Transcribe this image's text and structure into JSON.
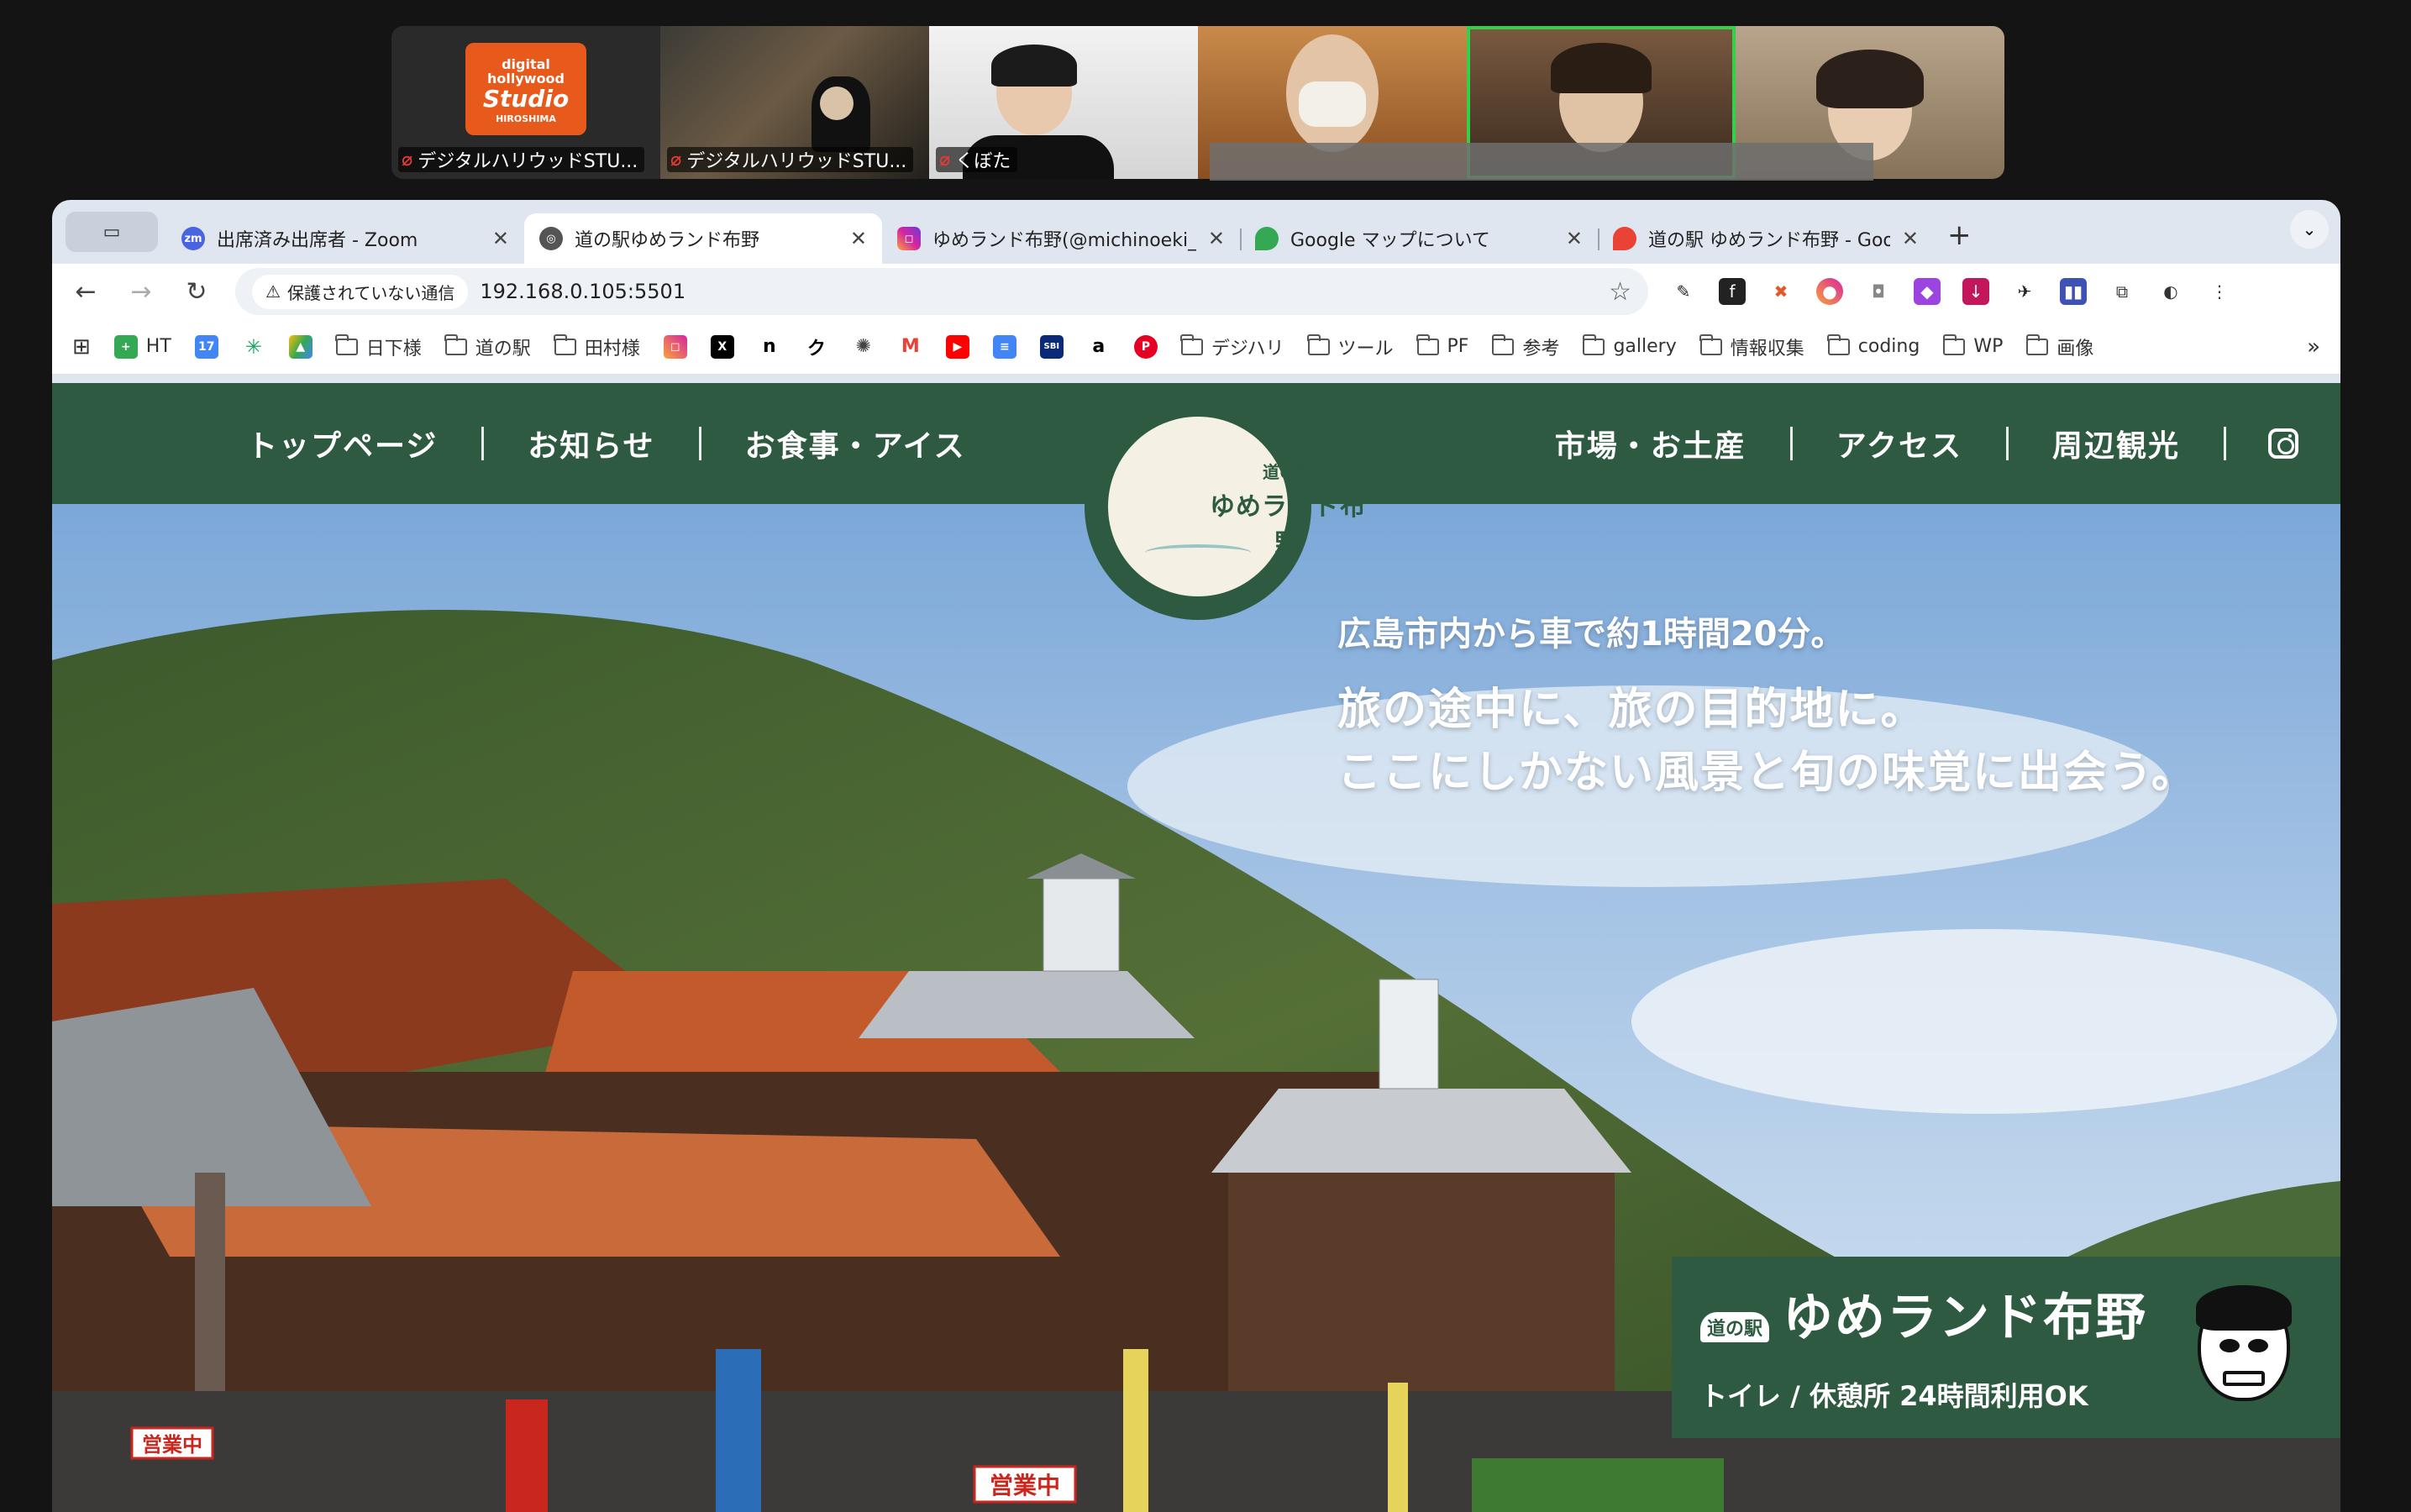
{
  "zoom": {
    "participants": [
      {
        "name": "デジタルハリウッドSTU...",
        "muted": true,
        "logo_text_top": "digital hollywood",
        "logo_text_main": "Studio",
        "logo_text_bottom": "HIROSHIMA"
      },
      {
        "name": "デジタルハリウッドSTU...",
        "muted": true
      },
      {
        "name": "くぼた",
        "muted": true
      },
      {
        "name": "",
        "muted": false
      },
      {
        "name": "",
        "muted": false,
        "active": true
      },
      {
        "name": "",
        "muted": false
      }
    ]
  },
  "browser": {
    "tabs": [
      {
        "label": "出席済み出席者 - Zoom",
        "icon": "zoom-icon"
      },
      {
        "label": "道の駅ゆめランド布野",
        "icon": "globe-icon",
        "active": true
      },
      {
        "label": "ゆめランド布野(@michinoeki_f",
        "icon": "instagram-icon"
      },
      {
        "label": "Google マップについて",
        "icon": "google-maps-icon"
      },
      {
        "label": "道の駅 ゆめランド布野 - Google",
        "icon": "google-maps-icon"
      }
    ],
    "security_label": "保護されていない通信",
    "url": "192.168.0.105:5501",
    "bookmarks": [
      {
        "label": "HT",
        "type": "icon"
      },
      {
        "label": "",
        "type": "icon"
      },
      {
        "label": "",
        "type": "icon"
      },
      {
        "label": "",
        "type": "icon"
      },
      {
        "label": "日下様",
        "type": "folder"
      },
      {
        "label": "道の駅",
        "type": "folder"
      },
      {
        "label": "田村様",
        "type": "folder"
      },
      {
        "label": "デジハリ",
        "type": "folder"
      },
      {
        "label": "ツール",
        "type": "folder"
      },
      {
        "label": "PF",
        "type": "folder"
      },
      {
        "label": "参考",
        "type": "folder"
      },
      {
        "label": "gallery",
        "type": "folder"
      },
      {
        "label": "情報収集",
        "type": "folder"
      },
      {
        "label": "coding",
        "type": "folder"
      },
      {
        "label": "WP",
        "type": "folder"
      },
      {
        "label": "画像",
        "type": "folder"
      }
    ]
  },
  "site": {
    "nav_left": [
      "トップページ",
      "お知らせ",
      "お食事・アイス"
    ],
    "nav_right": [
      "市場・お土産",
      "アクセス",
      "周辺観光"
    ],
    "logo": {
      "small": "道の駅",
      "main": "ゆめランド布野"
    },
    "tagline": {
      "line1": "広島市内から車で約1時間20分。",
      "line2": "旅の途中に、旅の目的地に。",
      "line3": "ここにしかない風景と旬の味覚に出会う。"
    },
    "info_box": {
      "small": "道の駅",
      "title": "ゆめランド布野",
      "subtitle": "トイレ / 休憩所 24時間利用OK"
    },
    "signs": {
      "open1": "営業中",
      "open2": "営業中"
    }
  },
  "colors": {
    "site_green": "#2d5a40",
    "tab_bar": "#dfe6f0",
    "active_tile": "#35d04a"
  }
}
